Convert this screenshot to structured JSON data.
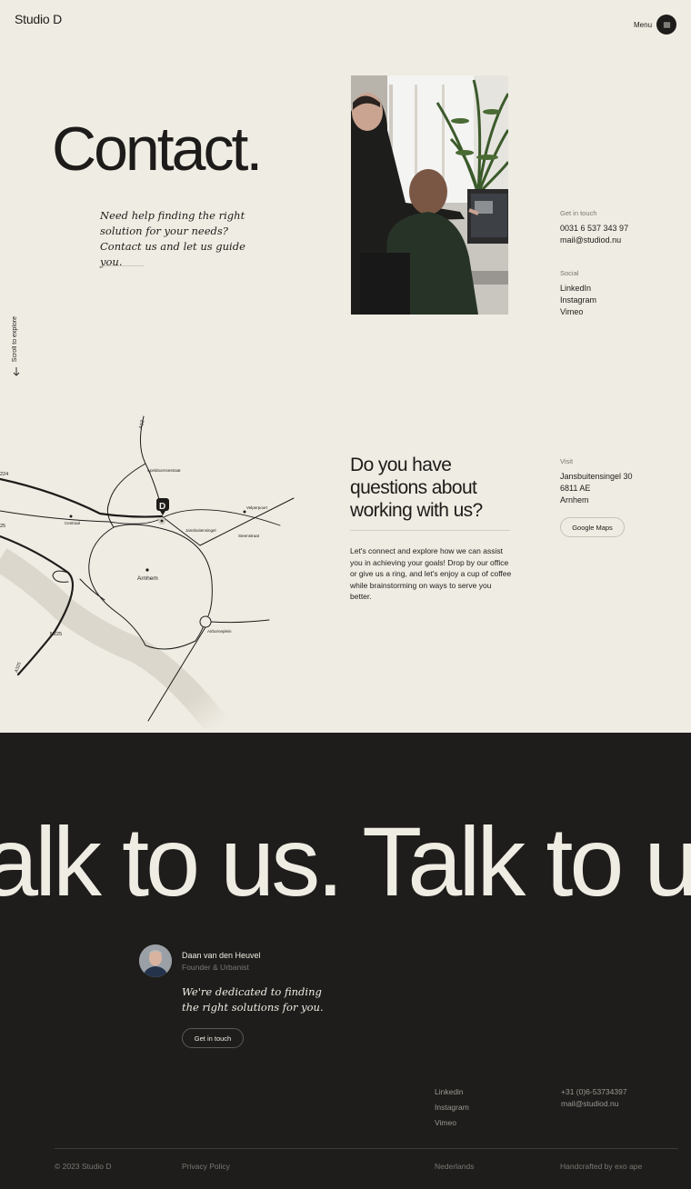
{
  "header": {
    "logo": "Studio D",
    "menu_label": "Menu",
    "menu_icon": "hamburger-icon"
  },
  "hero": {
    "title": "Contact.",
    "intro": "Need help finding the right solution for your needs?  Contact us and let us guide you.",
    "scroll_label": "Scroll to explore",
    "scroll_icon": "arrow-down-icon"
  },
  "contact": {
    "get_in_touch_label": "Get in touch",
    "phone": "0031 6 537 343 97",
    "email": "mail@studiod.nu",
    "social_label": "Social",
    "social_links": [
      "LinkedIn",
      "Instagram",
      "Vimeo"
    ]
  },
  "map": {
    "labels": [
      "A12",
      "224",
      "Apeldoornsestraat",
      "Velperpoort",
      "Centraal",
      "Jansbuitensingel",
      "Steenstraat",
      "25",
      "Arnhem",
      "N225",
      "Airborneplein",
      "A325"
    ],
    "marker": "D"
  },
  "visit_section": {
    "question": "Do you have questions about working with us?",
    "text": "Let's connect and explore how we can assist you in achieving your goals! Drop by our office or give us a ring, and let's enjoy a cup of coffee while brainstorming on ways to serve you better.",
    "visit_label": "Visit",
    "address": [
      "Jansbuitensingel 30",
      "6811 AE",
      "Arnhem"
    ],
    "maps_button": "Google Maps"
  },
  "footer": {
    "marquee": "alk to us. Talk to us",
    "person_name": "Daan van den Heuvel",
    "person_role": "Founder & Urbanist",
    "quote": "We're dedicated to finding the right solutions for you.",
    "cta": "Get in touch",
    "links": [
      "Linkedin",
      "Instagram",
      "Vimeo"
    ],
    "phone": "+31 (0)6-53734397",
    "email": "mail@studiod.nu",
    "copyright": "© 2023 Studio D",
    "privacy": "Privacy Policy",
    "language": "Nederlands",
    "credit": "Handcrafted by exo ape"
  },
  "colors": {
    "background": "#efece3",
    "dark": "#1e1d1b",
    "text": "#1d1c1a"
  }
}
